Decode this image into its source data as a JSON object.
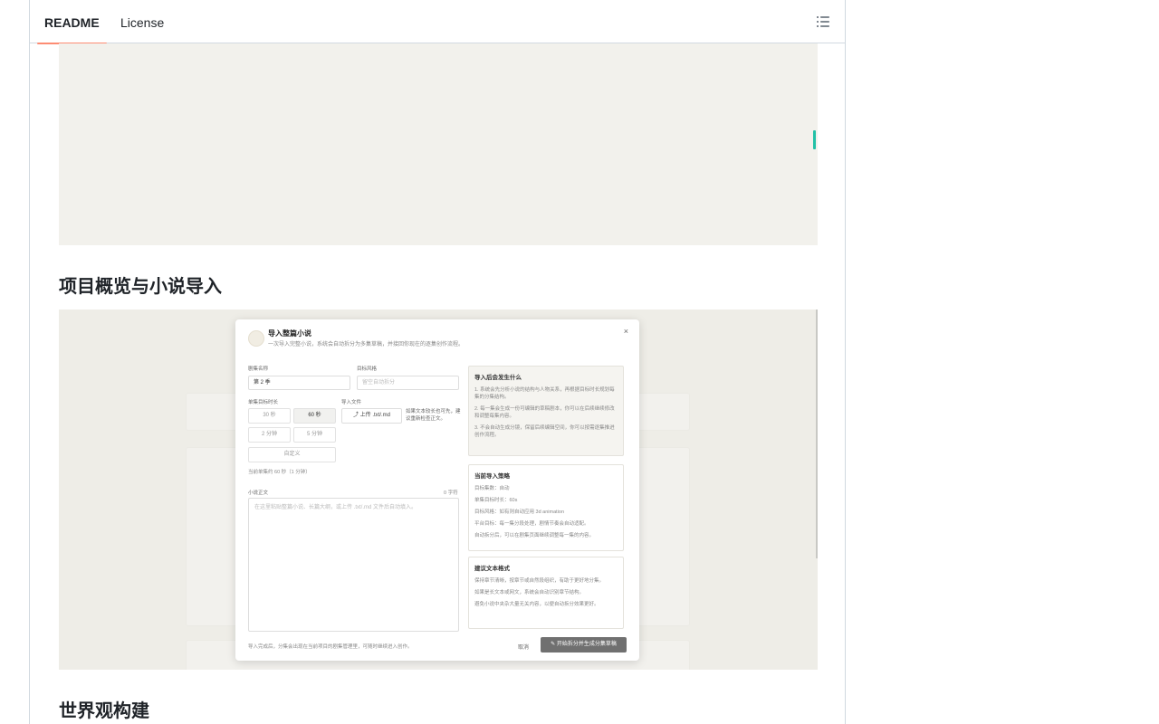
{
  "tabs": {
    "readme": "README",
    "license": "License",
    "toc_icon": "list-icon"
  },
  "sections": {
    "overview_heading": "项目概览与小说导入",
    "world_heading": "世界观构建"
  },
  "screenshot": {
    "modal": {
      "title": "导入整篇小说",
      "subtitle": "一次导入完整小说，系统会自动拆分为多集草稿，并接回你现在的逐集创作流程。",
      "close": "×",
      "name_label": "剧集名称",
      "name_value": "第 2 季",
      "style_label": "目标风格",
      "style_placeholder": "留空自动拆分",
      "duration_label": "单集目标时长",
      "durations": [
        "30 秒",
        "60 秒",
        "2 分钟",
        "5 分钟"
      ],
      "custom": "自定义",
      "import_label": "导入文件",
      "upload_label": "上传 .txt/.md",
      "upload_note": "如果文本较长也可先，建议重新检查正文。",
      "duration_hint": "当前单集约 60 秒（1 分钟）",
      "content_label": "小说正文",
      "char_count": "0 字符",
      "textarea_placeholder": "在这里粘贴整篇小说、长篇大纲，或上传 .txt/.md 文件后自动填入。",
      "card1_title": "导入后会发生什么",
      "card1_lines": [
        "1. 系统会先分析小说的结构与人物关系，再根据目标时长规划每集的分集结构。",
        "2. 每一集会生成一份可编辑的草稿剧本，你可以在后续继续修改和调整每集内容。",
        "3. 不会自动生成分镜，保留后续编辑空间，你可以按需逐集推进创作流程。"
      ],
      "card2_title": "当前导入策略",
      "card2_lines": [
        "目标集数：自动",
        "单集目标时长：60s",
        "目标风格：如有则自动应用 3d animation",
        "平台目标：每一集分段处理，剧情节奏会自动适配。",
        "自动拆分后，可以在剧集页面继续调整每一集的内容。"
      ],
      "card3_title": "建议文本格式",
      "card3_lines": [
        "保持章节清晰，按章节或自然段组织，有助于更好地分集。",
        "如果是长文本或网文，系统会自动识别章节结构。",
        "避免小说中夹杂大量无关内容，以便自动拆分效果更好。"
      ],
      "footer_note": "导入完成后，分集会出现在当前项目的剧集管理里，可随时继续进入创作。",
      "cancel": "取消",
      "primary": "开始拆分并生成分集草稿"
    }
  }
}
